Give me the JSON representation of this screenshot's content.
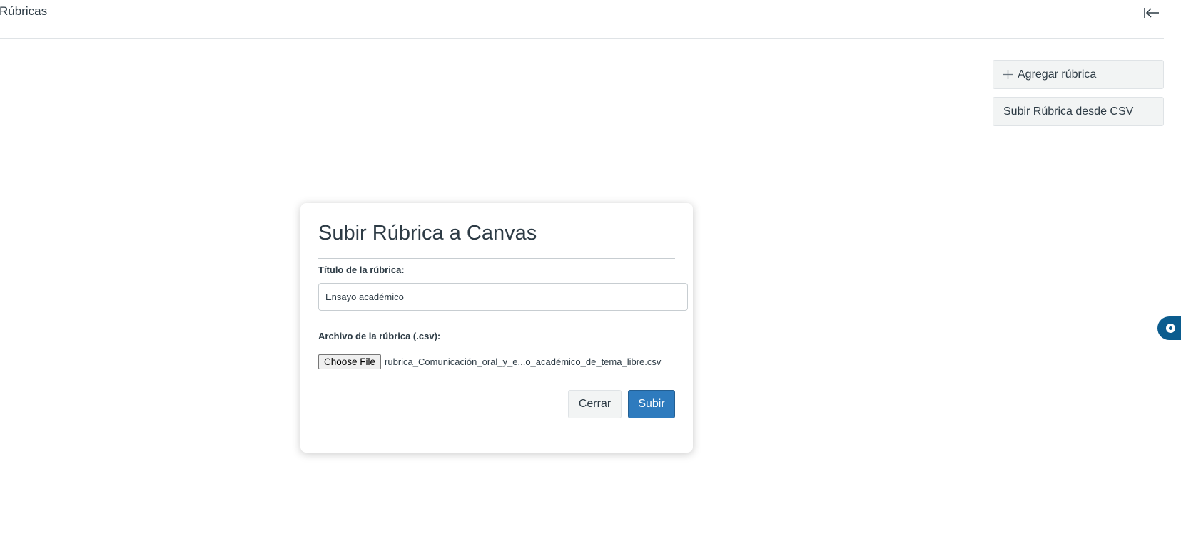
{
  "header": {
    "breadcrumb": "Rúbricas",
    "collapse_icon": "collapse-left-arrow-icon"
  },
  "actions": {
    "add_rubric_label": "Agregar rúbrica",
    "add_icon": "plus-icon",
    "upload_csv_label": "Subir Rúbrica desde CSV"
  },
  "modal": {
    "title": "Subir Rúbrica a Canvas",
    "title_field_label": "Título de la rúbrica:",
    "title_field_value": "Ensayo académico",
    "file_field_label": "Archivo de la rúbrica (.csv):",
    "choose_file_label": "Choose File",
    "file_name": "rubrica_Comunicación_oral_y_e...o_académico_de_tema_libre.csv",
    "close_label": "Cerrar",
    "submit_label": "Subir"
  },
  "help_tab": {
    "icon": "help-chat-icon"
  },
  "colors": {
    "primary": "#2e7bbe",
    "help_tab": "#0b5c8e",
    "text": "#2d3b45",
    "secondary_button": "#f2f4f4"
  }
}
